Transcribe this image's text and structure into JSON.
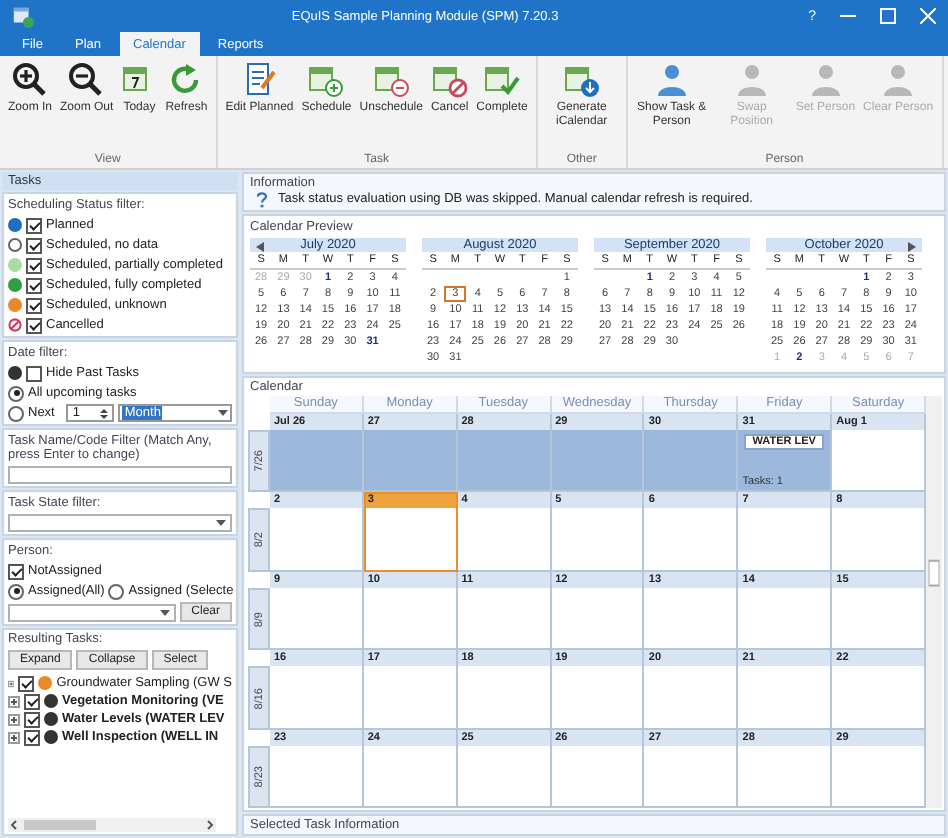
{
  "window": {
    "title": "EQuIS Sample Planning Module (SPM) 7.20.3",
    "help": "?"
  },
  "tabs": [
    {
      "label": "File",
      "selected": false
    },
    {
      "label": "Plan",
      "selected": false
    },
    {
      "label": "Calendar",
      "selected": true
    },
    {
      "label": "Reports",
      "selected": false
    }
  ],
  "ribbon": [
    {
      "label": "View",
      "buttons": [
        {
          "label": "Zoom In",
          "kind": "zoom-in",
          "disabled": false
        },
        {
          "label": "Zoom Out",
          "kind": "zoom-out",
          "disabled": false
        },
        {
          "label": "Today",
          "kind": "today",
          "disabled": false
        },
        {
          "label": "Refresh",
          "kind": "refresh",
          "disabled": false
        }
      ]
    },
    {
      "label": "Task",
      "buttons": [
        {
          "label": "Edit Planned",
          "kind": "edit",
          "disabled": false
        },
        {
          "label": "Schedule",
          "kind": "schedule",
          "disabled": false
        },
        {
          "label": "Unschedule",
          "kind": "unschedule",
          "disabled": false
        },
        {
          "label": "Cancel",
          "kind": "cancel",
          "disabled": false
        },
        {
          "label": "Complete",
          "kind": "complete",
          "disabled": false
        }
      ]
    },
    {
      "label": "Other",
      "buttons": [
        {
          "label": "Generate iCalendar",
          "kind": "ical",
          "disabled": false
        }
      ]
    },
    {
      "label": "Person",
      "buttons": [
        {
          "label": "Show Task & Person",
          "kind": "person",
          "disabled": false
        },
        {
          "label": "Swap Position",
          "kind": "person",
          "disabled": true
        },
        {
          "label": "Set Person",
          "kind": "person",
          "disabled": true
        },
        {
          "label": "Clear Person",
          "kind": "person",
          "disabled": true
        }
      ]
    }
  ],
  "tasks_panel": {
    "title": "Tasks",
    "status_filter": {
      "title": "Scheduling Status filter:",
      "items": [
        {
          "label": "Planned",
          "kind": "dot",
          "color": "#1e6fc0",
          "checked": true
        },
        {
          "label": "Scheduled, no data",
          "kind": "ring",
          "color": "#ffffff",
          "checked": true
        },
        {
          "label": "Scheduled, partially completed",
          "kind": "dot",
          "color": "#a8dca0",
          "checked": true
        },
        {
          "label": "Scheduled, fully completed",
          "kind": "dot",
          "color": "#2ea043",
          "checked": true
        },
        {
          "label": "Scheduled, unknown",
          "kind": "dot",
          "color": "#e8892c",
          "checked": true
        },
        {
          "label": "Cancelled",
          "kind": "cancel",
          "color": "#d03a5a",
          "checked": true
        }
      ]
    },
    "date_filter": {
      "title": "Date filter:",
      "hide_past": {
        "label": "Hide Past Tasks",
        "checked": false
      },
      "options": [
        {
          "label": "All upcoming tasks",
          "selected": true
        },
        {
          "label": "Next",
          "selected": false
        }
      ],
      "next_count": "1",
      "next_unit": "Month"
    },
    "name_filter": {
      "title": "Task Name/Code Filter (Match Any, press Enter to change)"
    },
    "state_filter": {
      "title": "Task State filter:"
    },
    "person": {
      "title": "Person:",
      "not_assigned": {
        "label": "NotAssigned",
        "checked": true
      },
      "options": [
        {
          "label": "Assigned(All)",
          "selected": true
        },
        {
          "label": "Assigned (Selecte",
          "selected": false
        }
      ],
      "clear": "Clear"
    },
    "results": {
      "title": "Resulting Tasks:",
      "buttons": [
        "Expand",
        "Collapse",
        "Select"
      ],
      "items": [
        {
          "label": "Groundwater Sampling (GW S",
          "color": "#e8892c",
          "checked": true,
          "bold": false
        },
        {
          "label": "Vegetation Monitoring (VE",
          "color": "#333333",
          "checked": true,
          "bold": true
        },
        {
          "label": "Water Levels (WATER LEV",
          "color": "#333333",
          "checked": true,
          "bold": true
        },
        {
          "label": "Well Inspection (WELL IN",
          "color": "#333333",
          "checked": true,
          "bold": true
        }
      ]
    }
  },
  "information": {
    "title": "Information",
    "message": "Task status evaluation using DB was skipped.  Manual calendar refresh is required."
  },
  "calendar_preview": {
    "title": "Calendar Preview",
    "months": [
      {
        "title": "July 2020",
        "weekdays": [
          "S",
          "M",
          "T",
          "W",
          "T",
          "F",
          "S"
        ],
        "weeks": [
          [
            {
              "day": "28",
              "kind": "other"
            },
            {
              "day": "29",
              "kind": "other"
            },
            {
              "day": "30",
              "kind": "other"
            },
            {
              "day": "1",
              "kind": "bold"
            },
            "2",
            "3",
            "4"
          ],
          [
            "5",
            "6",
            "7",
            "8",
            "9",
            "10",
            "11"
          ],
          [
            "12",
            "13",
            "14",
            "15",
            "16",
            "17",
            "18"
          ],
          [
            "19",
            "20",
            "21",
            "22",
            "23",
            "24",
            "25"
          ],
          [
            "26",
            "27",
            "28",
            "29",
            "30",
            {
              "day": "31",
              "kind": "bold"
            }
          ]
        ]
      },
      {
        "title": "August 2020",
        "weekdays": [
          "S",
          "M",
          "T",
          "W",
          "T",
          "F",
          "S"
        ],
        "weeks": [
          [
            {
              "kind": "blank"
            },
            {
              "kind": "blank"
            },
            {
              "kind": "blank"
            },
            {
              "kind": "blank"
            },
            {
              "kind": "blank"
            },
            {
              "kind": "blank"
            },
            "1"
          ],
          [
            "2",
            {
              "day": "3",
              "kind": "today"
            },
            "4",
            "5",
            "6",
            "7",
            "8"
          ],
          [
            "9",
            "10",
            "11",
            "12",
            "13",
            "14",
            "15"
          ],
          [
            "16",
            "17",
            "18",
            "19",
            "20",
            "21",
            "22"
          ],
          [
            "23",
            "24",
            "25",
            "26",
            "27",
            "28",
            "29"
          ],
          [
            "30",
            "31"
          ]
        ]
      },
      {
        "title": "September 2020",
        "weekdays": [
          "S",
          "M",
          "T",
          "W",
          "T",
          "F",
          "S"
        ],
        "weeks": [
          [
            {
              "kind": "blank"
            },
            {
              "kind": "blank"
            },
            {
              "day": "1",
              "kind": "bold"
            },
            "2",
            "3",
            "4",
            "5"
          ],
          [
            "6",
            "7",
            "8",
            "9",
            "10",
            "11",
            "12"
          ],
          [
            "13",
            "14",
            "15",
            "16",
            "17",
            "18",
            "19"
          ],
          [
            "20",
            "21",
            "22",
            "23",
            "24",
            "25",
            "26"
          ],
          [
            "27",
            "28",
            "29",
            "30"
          ]
        ]
      },
      {
        "title": "October 2020",
        "weekdays": [
          "S",
          "M",
          "T",
          "W",
          "T",
          "F",
          "S"
        ],
        "weeks": [
          [
            {
              "kind": "blank"
            },
            {
              "kind": "blank"
            },
            {
              "kind": "blank"
            },
            {
              "kind": "blank"
            },
            {
              "day": "1",
              "kind": "bold"
            },
            "2",
            "3"
          ],
          [
            "4",
            "5",
            "6",
            "7",
            "8",
            "9",
            "10"
          ],
          [
            "11",
            "12",
            "13",
            "14",
            "15",
            "16",
            "17"
          ],
          [
            "18",
            "19",
            "20",
            "21",
            "22",
            "23",
            "24"
          ],
          [
            "25",
            "26",
            "27",
            "28",
            "29",
            "30",
            "31"
          ],
          [
            {
              "day": "1",
              "kind": "other"
            },
            {
              "day": "2",
              "kind": "bold"
            },
            {
              "day": "3",
              "kind": "other"
            },
            {
              "day": "4",
              "kind": "other"
            },
            {
              "day": "5",
              "kind": "other"
            },
            {
              "day": "6",
              "kind": "other"
            },
            {
              "day": "7",
              "kind": "other"
            }
          ]
        ]
      }
    ]
  },
  "calendar": {
    "title": "Calendar",
    "weekdays": [
      "Sunday",
      "Monday",
      "Tuesday",
      "Wednesday",
      "Thursday",
      "Friday",
      "Saturday"
    ],
    "weeks": [
      {
        "label": "7/26",
        "days": [
          {
            "date": "Jul 26",
            "selected": true,
            "today": false
          },
          {
            "date": "27",
            "selected": true,
            "today": false
          },
          {
            "date": "28",
            "selected": true,
            "today": false
          },
          {
            "date": "29",
            "selected": true,
            "today": false
          },
          {
            "date": "30",
            "selected": true,
            "today": false
          },
          {
            "date": "31",
            "selected": true,
            "today": false,
            "events": [
              "WATER LEV"
            ],
            "footer": "Tasks: 1"
          },
          {
            "date": "Aug 1",
            "selected": false,
            "today": false
          }
        ]
      },
      {
        "label": "8/2",
        "days": [
          {
            "date": "2",
            "selected": false,
            "today": false
          },
          {
            "date": "3",
            "selected": false,
            "today": true
          },
          {
            "date": "4",
            "selected": false,
            "today": false
          },
          {
            "date": "5",
            "selected": false,
            "today": false
          },
          {
            "date": "6",
            "selected": false,
            "today": false
          },
          {
            "date": "7",
            "selected": false,
            "today": false
          },
          {
            "date": "8",
            "selected": false,
            "today": false
          }
        ]
      },
      {
        "label": "8/9",
        "days": [
          {
            "date": "9",
            "selected": false,
            "today": false
          },
          {
            "date": "10",
            "selected": false,
            "today": false
          },
          {
            "date": "11",
            "selected": false,
            "today": false
          },
          {
            "date": "12",
            "selected": false,
            "today": false
          },
          {
            "date": "13",
            "selected": false,
            "today": false
          },
          {
            "date": "14",
            "selected": false,
            "today": false
          },
          {
            "date": "15",
            "selected": false,
            "today": false
          }
        ]
      },
      {
        "label": "8/16",
        "days": [
          {
            "date": "16",
            "selected": false,
            "today": false
          },
          {
            "date": "17",
            "selected": false,
            "today": false
          },
          {
            "date": "18",
            "selected": false,
            "today": false
          },
          {
            "date": "19",
            "selected": false,
            "today": false
          },
          {
            "date": "20",
            "selected": false,
            "today": false
          },
          {
            "date": "21",
            "selected": false,
            "today": false
          },
          {
            "date": "22",
            "selected": false,
            "today": false
          }
        ]
      },
      {
        "label": "8/23",
        "days": [
          {
            "date": "23",
            "selected": false,
            "today": false
          },
          {
            "date": "24",
            "selected": false,
            "today": false
          },
          {
            "date": "25",
            "selected": false,
            "today": false
          },
          {
            "date": "26",
            "selected": false,
            "today": false
          },
          {
            "date": "27",
            "selected": false,
            "today": false
          },
          {
            "date": "28",
            "selected": false,
            "today": false
          },
          {
            "date": "29",
            "selected": false,
            "today": false
          }
        ]
      }
    ]
  },
  "selected_task_info": {
    "title": "Selected Task Information"
  }
}
